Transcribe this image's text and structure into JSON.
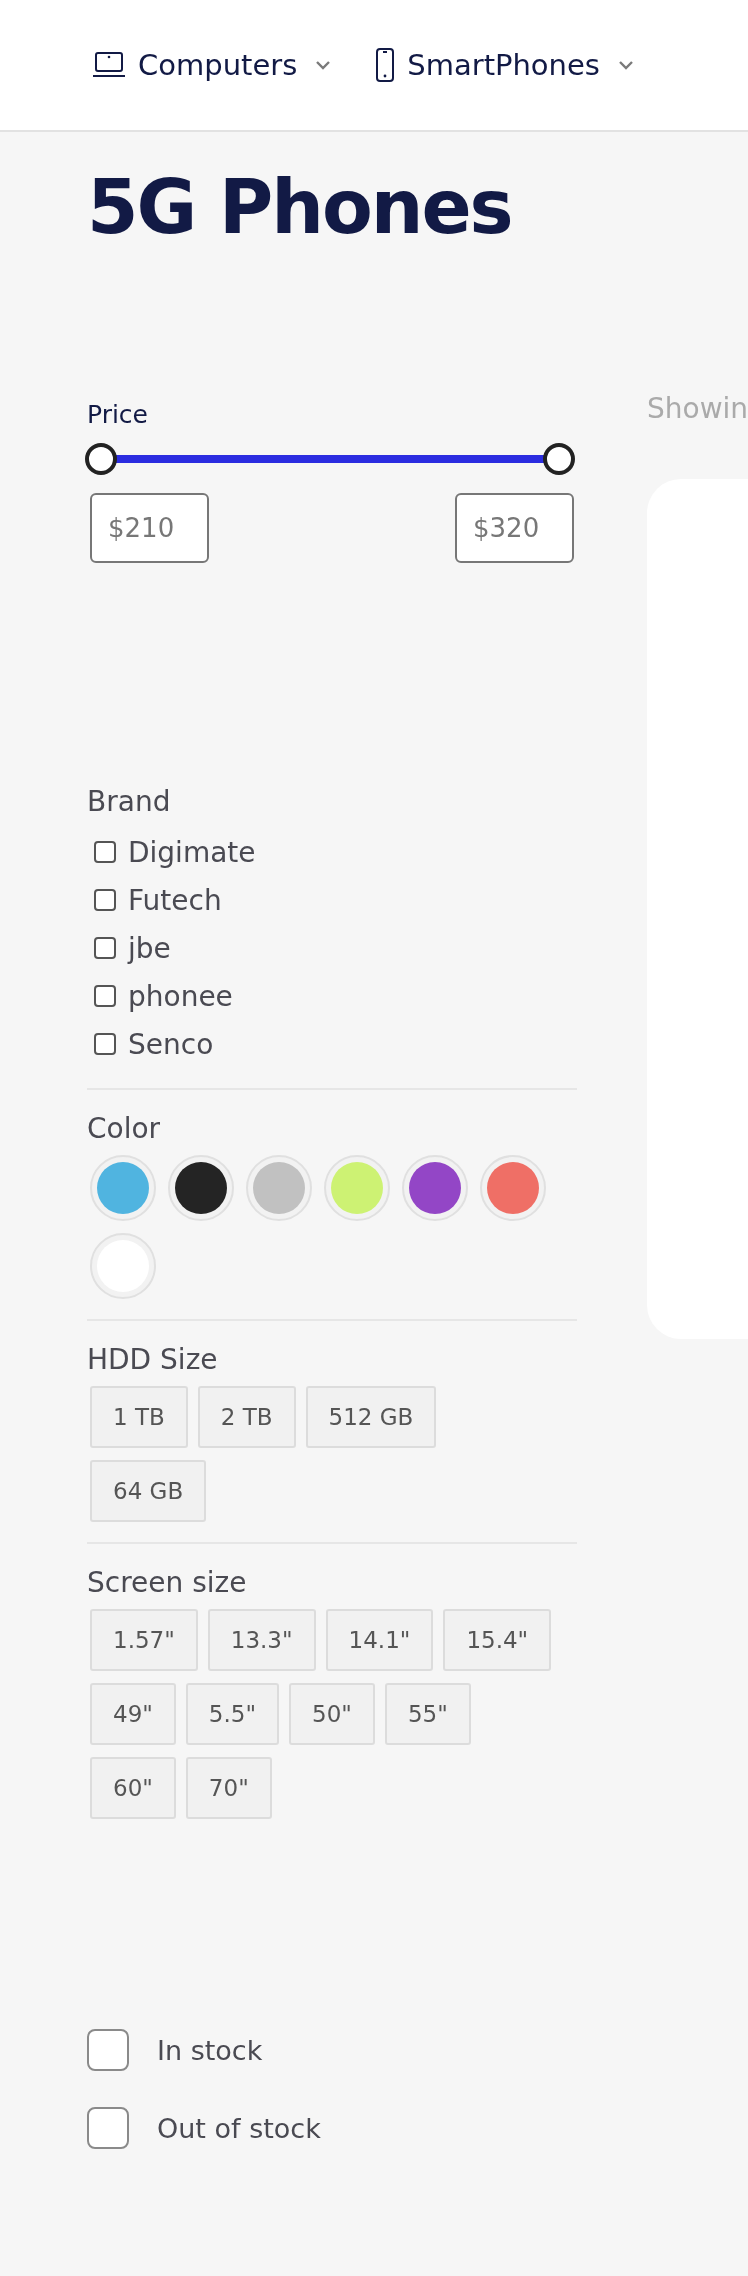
{
  "nav": [
    {
      "kind": "laptop",
      "label": "Computers"
    },
    {
      "kind": "phone",
      "label": "SmartPhones"
    }
  ],
  "title": "5G Phones",
  "showing": "Showin",
  "price": {
    "label": "Price",
    "level": 1,
    "min_field": {
      "placeholder": "$210"
    },
    "max_field": {
      "placeholder": "$320"
    }
  },
  "brand": {
    "label": "Brand",
    "items": [
      {
        "label": "Digimate",
        "checked": false
      },
      {
        "label": "Futech",
        "checked": false
      },
      {
        "label": "jbe",
        "checked": false
      },
      {
        "label": "phonee",
        "checked": false
      },
      {
        "label": "Senco",
        "checked": false
      }
    ]
  },
  "color": {
    "label": "Color",
    "swatches": [
      {
        "color": "#50b4e0",
        "selected": false
      },
      {
        "color": "#242424",
        "selected": false
      },
      {
        "color": "#c1c1c1",
        "selected": false
      },
      {
        "color": "#cdf273",
        "selected": false
      },
      {
        "color": "#9346c6",
        "selected": false
      },
      {
        "color": "#ef6f66",
        "selected": false
      },
      {
        "color": "#ffffff",
        "selected": false
      }
    ]
  },
  "hdd": {
    "label": "HDD Size",
    "options": [
      {
        "label": "1 TB",
        "selected": false
      },
      {
        "label": "2 TB",
        "selected": false
      },
      {
        "label": "512 GB",
        "selected": false
      },
      {
        "label": "64 GB",
        "selected": false
      }
    ]
  },
  "screen": {
    "label": "Screen size",
    "options": [
      {
        "label": "1.57\"",
        "selected": false
      },
      {
        "label": "13.3\"",
        "selected": false
      },
      {
        "label": "14.1\"",
        "selected": false
      },
      {
        "label": "15.4\"",
        "selected": false
      },
      {
        "label": "49\"",
        "selected": false
      },
      {
        "label": "5.5\"",
        "selected": false
      },
      {
        "label": "50\"",
        "selected": false
      },
      {
        "label": "55\"",
        "selected": false
      },
      {
        "label": "60\"",
        "selected": false
      },
      {
        "label": "70\"",
        "selected": false
      }
    ]
  },
  "stock": [
    {
      "label": "In stock",
      "checked": false
    },
    {
      "label": "Out of stock",
      "checked": false
    }
  ]
}
